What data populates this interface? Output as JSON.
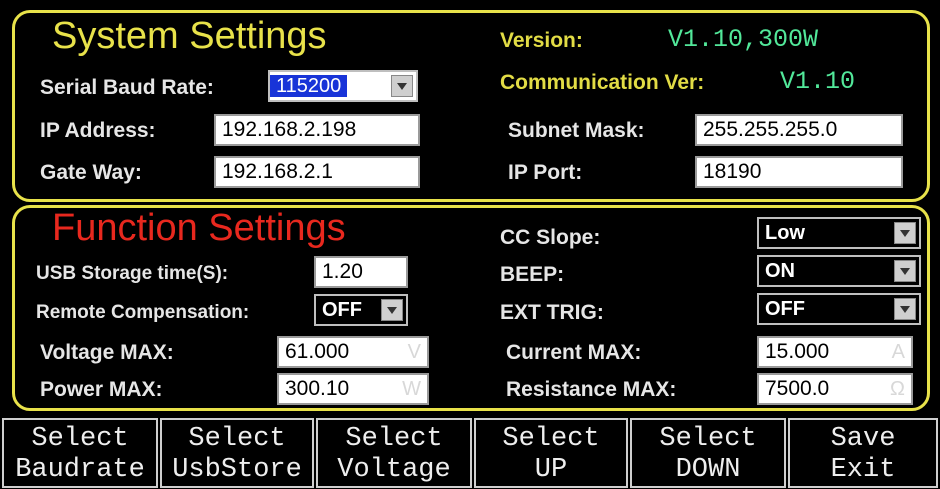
{
  "system": {
    "title": "System Settings",
    "version_label": "Version:",
    "version_value": "V1.10,300W",
    "comm_label": "Communication Ver:",
    "comm_value": "V1.10",
    "baud_label": "Serial Baud Rate:",
    "baud_value": "115200",
    "ip_label": "IP Address:",
    "ip_value": "192.168.2.198",
    "subnet_label": "Subnet Mask:",
    "subnet_value": "255.255.255.0",
    "gateway_label": "Gate Way:",
    "gateway_value": "192.168.2.1",
    "port_label": "IP Port:",
    "port_value": "18190"
  },
  "function": {
    "title": "Function Settings",
    "usb_label": "USB Storage time(S):",
    "usb_value": "1.20",
    "remote_label": "Remote Compensation:",
    "remote_value": "OFF",
    "vmax_label": "Voltage MAX:",
    "vmax_value": "61.000",
    "vmax_unit": "V",
    "pmax_label": "Power MAX:",
    "pmax_value": "300.10",
    "pmax_unit": "W",
    "ccslope_label": "CC Slope:",
    "ccslope_value": "Low",
    "beep_label": "BEEP:",
    "beep_value": "ON",
    "exttrig_label": "EXT TRIG:",
    "exttrig_value": "OFF",
    "imax_label": "Current MAX:",
    "imax_value": "15.000",
    "imax_unit": "A",
    "rmax_label": "Resistance MAX:",
    "rmax_value": "7500.0",
    "rmax_unit": "Ω"
  },
  "softkeys": [
    {
      "line1": "Select",
      "line2": "Baudrate"
    },
    {
      "line1": "Select",
      "line2": "UsbStore"
    },
    {
      "line1": "Select",
      "line2": "Voltage"
    },
    {
      "line1": "Select",
      "line2": "UP"
    },
    {
      "line1": "Select",
      "line2": "DOWN"
    },
    {
      "line1": "Save",
      "line2": "Exit"
    }
  ],
  "colors": {
    "panel_border": "#e8e24a",
    "system_title": "#e8e24a",
    "function_title": "#e8281e",
    "value_green": "#52e89a",
    "selected_blue": "#1834d8"
  }
}
